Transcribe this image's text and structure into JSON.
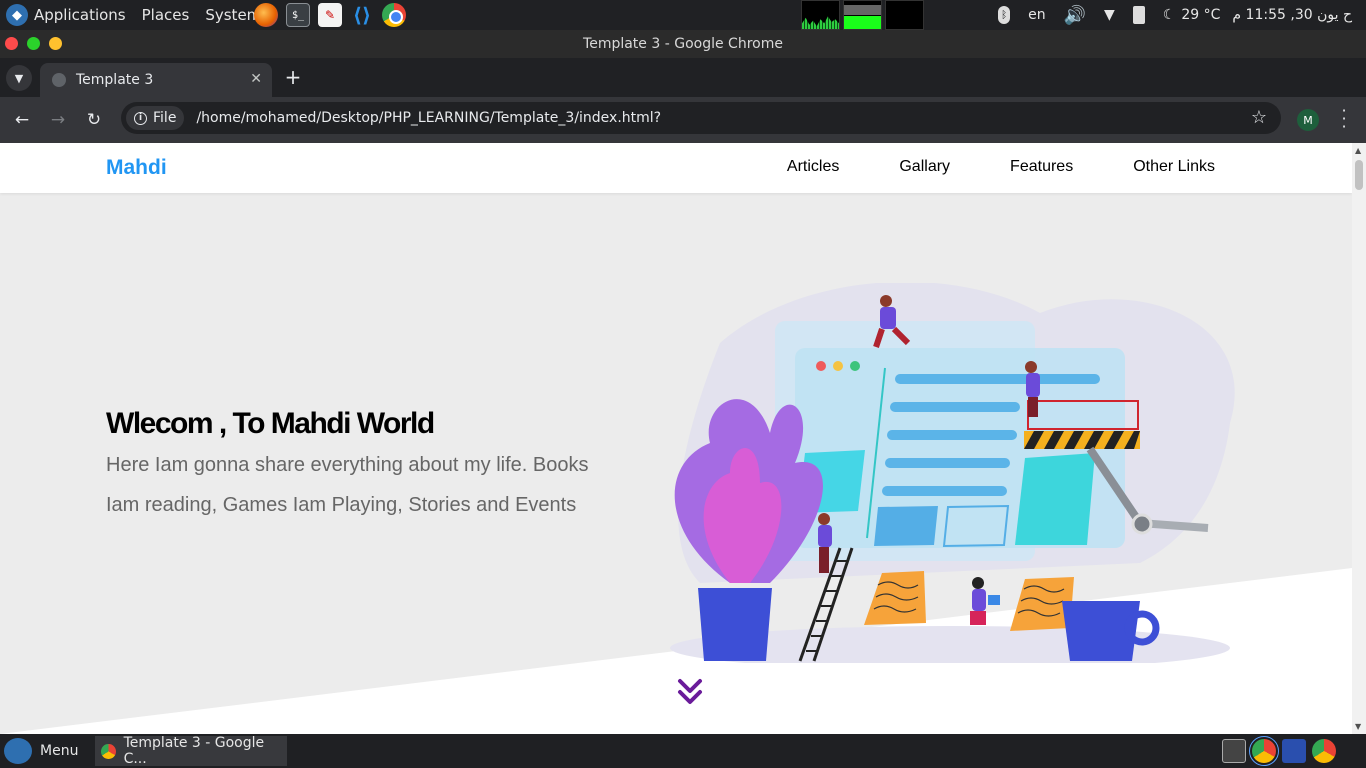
{
  "system_panel": {
    "menus": [
      "Applications",
      "Places",
      "System"
    ],
    "launchers": [
      "firefox-icon",
      "terminal-icon",
      "text-editor-icon",
      "vscode-icon",
      "chrome-icon"
    ],
    "keyboard_layout": "en",
    "temperature": "29 °C",
    "datetime": "ح يون 30, 11:55 م"
  },
  "window": {
    "title": "Template 3 - Google Chrome"
  },
  "browser": {
    "tab_title": "Template 3",
    "url_chip": "File",
    "url": "/home/mohamed/Desktop/PHP_LEARNING/Template_3/index.html?",
    "profile_initial": "M"
  },
  "site": {
    "logo": "Mahdi",
    "nav": [
      "Articles",
      "Gallary",
      "Features",
      "Other Links"
    ],
    "hero_title": "Wlecom , To Mahdi World",
    "hero_text": "Here Iam gonna share everything about my life. Books Iam reading, Games Iam Playing, Stories and Events",
    "brand_color": "#2196f3",
    "accent_color": "#6a1b9a"
  },
  "taskbar": {
    "menu_label": "Menu",
    "task_title": "Template 3 - Google C..."
  }
}
